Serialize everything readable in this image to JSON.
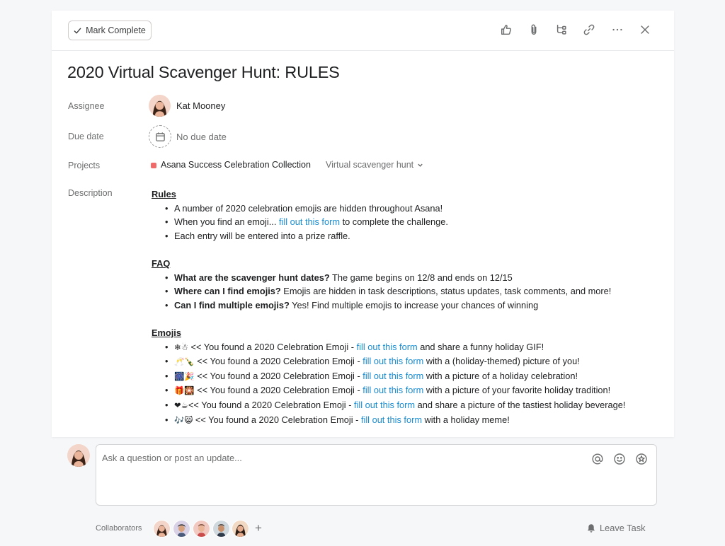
{
  "toolbar": {
    "mark_complete_label": "Mark Complete",
    "icons": [
      "like-icon",
      "attachment-icon",
      "subtask-icon",
      "link-icon",
      "more-icon",
      "close-icon"
    ]
  },
  "task": {
    "title": "2020 Virtual Scavenger Hunt: RULES"
  },
  "fields": {
    "assignee_label": "Assignee",
    "assignee_name": "Kat Mooney",
    "due_label": "Due date",
    "due_value": "No due date",
    "projects_label": "Projects",
    "project_name": "Asana Success Celebration Collection",
    "project_color": "#f06a6a",
    "project_section": "Virtual scavenger hunt",
    "description_label": "Description"
  },
  "description": {
    "rules_heading": "Rules",
    "rules": {
      "item1": "A number of 2020 celebration emojis are hidden throughout Asana!",
      "item2_before": "When you find an emoji... ",
      "item2_link": "fill out this form",
      "item2_after": " to complete the challenge.",
      "item3": "Each entry will be entered into a prize raffle."
    },
    "faq_heading": "FAQ",
    "faq": [
      {
        "q": "What are the scavenger hunt dates?",
        "a": " The game begins on 12/8 and ends on 12/15"
      },
      {
        "q": "Where can I find emojis?",
        "a": " Emojis are hidden in task descriptions, status updates, task comments, and more!"
      },
      {
        "q": "Can I find multiple emojis?",
        "a": " Yes! Find multiple emojis to increase your chances of winning"
      }
    ],
    "emojis_heading": "Emojis",
    "emojis": [
      {
        "emoji": "❄☃",
        "lead": " << You found a 2020 Celebration Emoji - ",
        "link": "fill out this form",
        "tail": " and share a funny holiday GIF!"
      },
      {
        "emoji": "🥂🍾",
        "lead": " << You found a 2020 Celebration Emoji - ",
        "link": "fill out this form",
        "tail": " with a (holiday-themed) picture of you!"
      },
      {
        "emoji": "🎆🎉",
        "lead": " << You found a 2020 Celebration Emoji - ",
        "link": "fill out this form",
        "tail": " with a picture of a holiday celebration!"
      },
      {
        "emoji": "🎁🎇",
        "lead": " << You found a 2020 Celebration Emoji - ",
        "link": "fill out this form",
        "tail": " with a picture of your favorite holiday tradition!"
      },
      {
        "emoji": "❤☕",
        "lead": "<< You found a 2020 Celebration Emoji - ",
        "link": "fill out this form",
        "tail": " and share a picture of the tastiest holiday beverage!"
      },
      {
        "emoji": "🎶😸",
        "lead": " << You found a 2020 Celebration Emoji - ",
        "link": "fill out this form",
        "tail": " with a holiday meme!"
      }
    ]
  },
  "comment": {
    "placeholder": "Ask a question or post an update..."
  },
  "footer": {
    "collaborators_label": "Collaborators",
    "add_symbol": "+",
    "leave_task_label": "Leave Task"
  },
  "colors": {
    "link": "#1a8cd0",
    "text": "#1e1f21",
    "muted": "#6d6e6f"
  }
}
